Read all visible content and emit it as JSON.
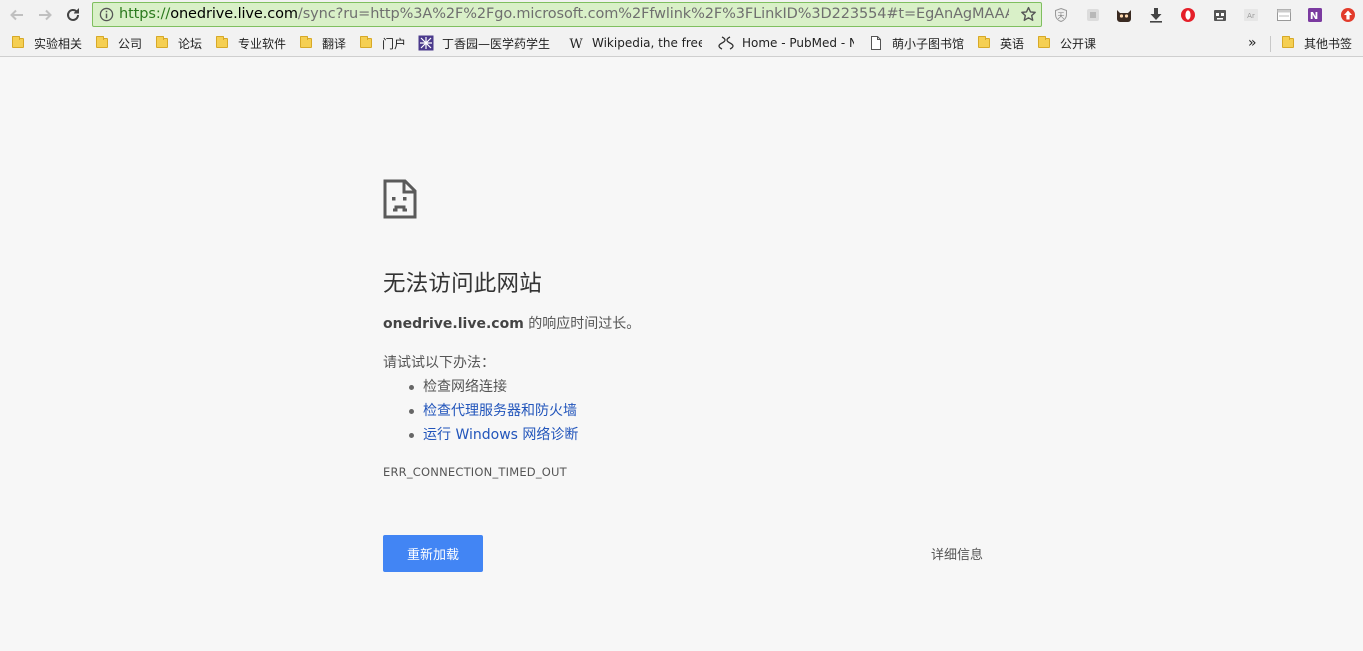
{
  "browser": {
    "url_scheme": "https://",
    "url_host": "onedrive.live.com",
    "url_rest": "/sync?ru=http%3A%2F%2Fgo.microsoft.com%2Ffwlink%2F%3FLinkID%3D223554#t=EgAnAgMAAAAEgAA...",
    "accent_color": "#4285f4"
  },
  "bookmarks": [
    {
      "label": "实验相关",
      "icon": "folder-icon"
    },
    {
      "label": "公司",
      "icon": "folder-icon"
    },
    {
      "label": "论坛",
      "icon": "folder-icon"
    },
    {
      "label": "专业软件",
      "icon": "folder-icon"
    },
    {
      "label": "翻译",
      "icon": "folder-icon"
    },
    {
      "label": "门户",
      "icon": "folder-icon"
    },
    {
      "label": "丁香园—医学药学生",
      "icon": "dxy-icon"
    },
    {
      "label": "Wikipedia, the free",
      "icon": "wikipedia-icon"
    },
    {
      "label": "Home - PubMed - N",
      "icon": "pubmed-icon"
    },
    {
      "label": "萌小子图书馆",
      "icon": "page-icon"
    },
    {
      "label": "英语",
      "icon": "folder-icon"
    },
    {
      "label": "公开课",
      "icon": "folder-icon"
    }
  ],
  "bookmarks_overflow": "»",
  "other_bookmarks": "其他书签",
  "error": {
    "title": "无法访问此网站",
    "host": "onedrive.live.com",
    "summary_suffix": " 的响应时间过长。",
    "suggest_title": "请试试以下办法：",
    "suggestions": [
      {
        "text": "检查网络连接",
        "link": false
      },
      {
        "text": "检查代理服务器和防火墙",
        "link": true
      },
      {
        "text": "运行 Windows 网络诊断",
        "link": true
      }
    ],
    "code": "ERR_CONNECTION_TIMED_OUT",
    "reload_label": "重新加载",
    "details_label": "详细信息"
  }
}
